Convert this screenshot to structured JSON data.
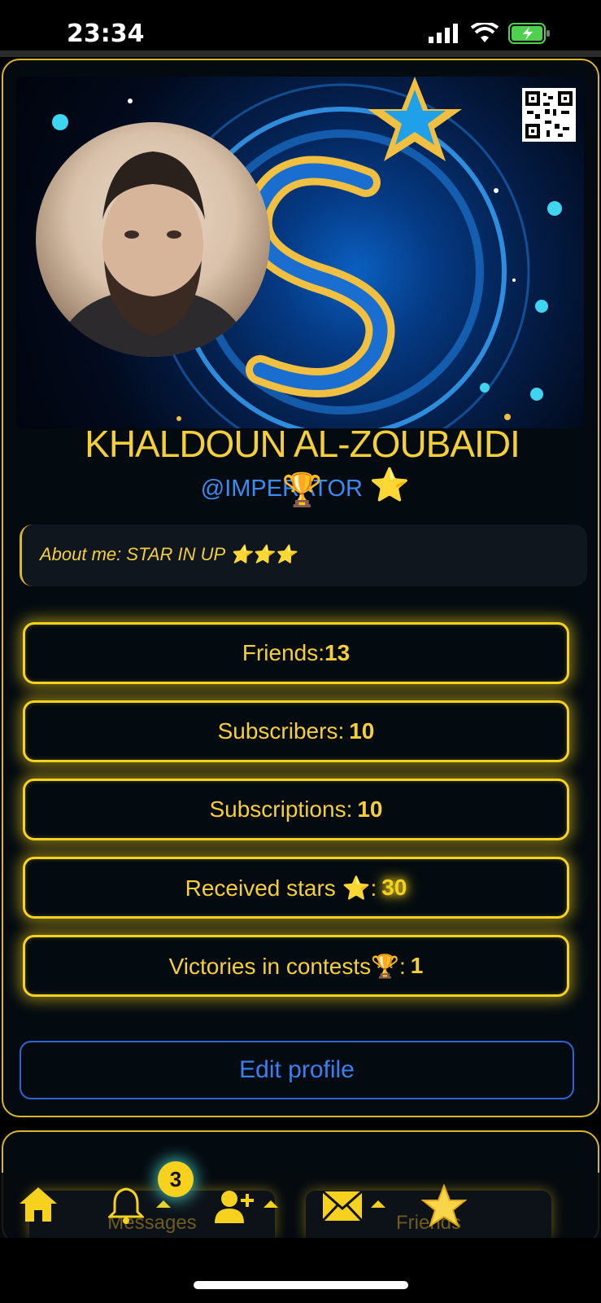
{
  "status_bar": {
    "time": "23:34",
    "icons": [
      "signal-icon",
      "wifi-icon",
      "battery-charging-icon"
    ]
  },
  "profile": {
    "name": "KHALDOUN AL-ZOUBAIDI",
    "handle": "@IMPERATOR",
    "handle_badge": "⭐",
    "trophy": "🏆",
    "about": "About me: STAR IN UP ⭐⭐⭐"
  },
  "stats": {
    "friends_label": "Friends:",
    "friends_value": "13",
    "subscribers_label": "Subscribers:",
    "subscribers_value": "10",
    "subscriptions_label": "Subscriptions:",
    "subscriptions_value": "10",
    "stars_label": "Received stars ⭐:",
    "stars_value": "30",
    "victories_label": "Victories in contests🏆:",
    "victories_value": "1"
  },
  "edit_button": "Edit profile",
  "nav": {
    "badge_count": "3",
    "messages_label": "Messages",
    "friends_label": "Friends",
    "icons": [
      "home-icon",
      "bell-icon",
      "add-user-icon",
      "mail-icon",
      "star-icon"
    ]
  },
  "colors": {
    "accent_yellow": "#f6d21e",
    "link_blue": "#3a7ff2",
    "background": "#040b10"
  }
}
